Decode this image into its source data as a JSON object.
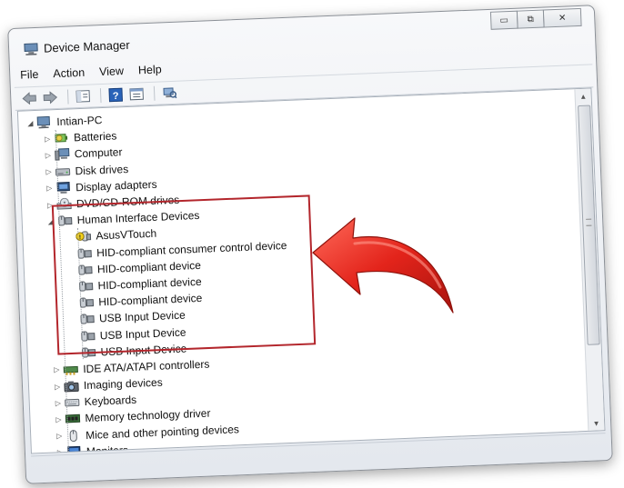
{
  "window": {
    "title": "Device Manager",
    "controls": {
      "minimize": "▭",
      "restore": "⧉",
      "close": "✕"
    }
  },
  "menu": [
    "File",
    "Action",
    "View",
    "Help"
  ],
  "toolbar": [
    "back-icon",
    "forward-icon",
    "properties-icon",
    "help-icon",
    "show-hide-icon",
    "scan-hardware-icon"
  ],
  "tree": {
    "root": "Intian-PC",
    "categories": [
      {
        "label": "Batteries",
        "icon": "battery-icon"
      },
      {
        "label": "Computer",
        "icon": "computer-icon"
      },
      {
        "label": "Disk drives",
        "icon": "disk-drive-icon"
      },
      {
        "label": "Display adapters",
        "icon": "display-adapter-icon"
      },
      {
        "label": "DVD/CD-ROM drives",
        "icon": "dvd-drive-icon"
      }
    ],
    "expanded": {
      "label": "Human Interface Devices",
      "icon": "hid-icon",
      "children": [
        {
          "label": "AsusVTouch",
          "icon": "hid-warning-icon"
        },
        {
          "label": "HID-compliant consumer control device",
          "icon": "hid-icon"
        },
        {
          "label": "HID-compliant device",
          "icon": "hid-icon"
        },
        {
          "label": "HID-compliant device",
          "icon": "hid-icon"
        },
        {
          "label": "HID-compliant device",
          "icon": "hid-icon"
        },
        {
          "label": "USB Input Device",
          "icon": "hid-icon"
        },
        {
          "label": "USB Input Device",
          "icon": "hid-icon"
        },
        {
          "label": "USB Input Device",
          "icon": "hid-icon"
        }
      ]
    },
    "more_categories": [
      {
        "label": "IDE ATA/ATAPI controllers",
        "icon": "ide-controller-icon"
      },
      {
        "label": "Imaging devices",
        "icon": "camera-icon"
      },
      {
        "label": "Keyboards",
        "icon": "keyboard-icon"
      },
      {
        "label": "Memory technology driver",
        "icon": "memory-icon"
      },
      {
        "label": "Mice and other pointing devices",
        "icon": "mouse-icon"
      },
      {
        "label": "Monitors",
        "icon": "monitor-icon"
      }
    ]
  },
  "colors": {
    "highlight": "#b3262c",
    "arrow": "#e3241b",
    "selection": "#3399ff"
  }
}
